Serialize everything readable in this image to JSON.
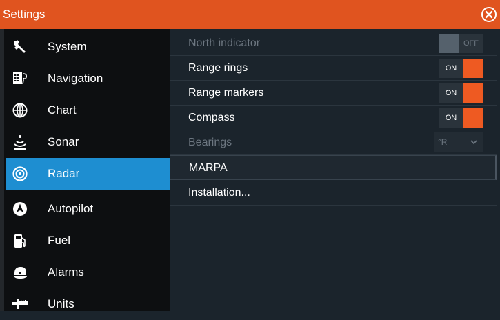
{
  "window": {
    "title": "Settings"
  },
  "sidebar": {
    "items": [
      {
        "label": "System",
        "icon": "wrench-icon"
      },
      {
        "label": "Navigation",
        "icon": "navigation-icon"
      },
      {
        "label": "Chart",
        "icon": "globe-icon"
      },
      {
        "label": "Sonar",
        "icon": "sonar-icon"
      },
      {
        "label": "Radar",
        "icon": "radar-icon",
        "selected": true
      },
      {
        "label": "Autopilot",
        "icon": "autopilot-icon"
      },
      {
        "label": "Fuel",
        "icon": "fuel-icon"
      },
      {
        "label": "Alarms",
        "icon": "alarm-icon"
      },
      {
        "label": "Units",
        "icon": "units-icon"
      }
    ]
  },
  "panel": {
    "north_indicator": {
      "label": "North indicator",
      "state": "OFF"
    },
    "range_rings": {
      "label": "Range rings",
      "state": "ON"
    },
    "range_markers": {
      "label": "Range markers",
      "state": "ON"
    },
    "compass": {
      "label": "Compass",
      "state": "ON"
    },
    "bearings": {
      "label": "Bearings",
      "value": "°R"
    },
    "marpa": {
      "label": "MARPA"
    },
    "installation": {
      "label": "Installation..."
    }
  },
  "colors": {
    "titlebar": "#e0541f",
    "selected": "#1e8ed1",
    "toggle_on": "#ee5a22",
    "panel_bg": "#1b242c",
    "sidebar_bg": "#0d0f11"
  }
}
